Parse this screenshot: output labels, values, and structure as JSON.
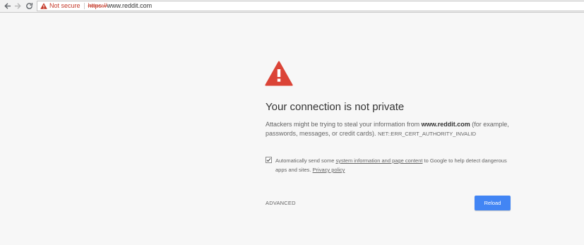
{
  "browser": {
    "security_label": "Not secure",
    "url_scheme": "https://",
    "url_host": "www.reddit.com"
  },
  "interstitial": {
    "heading": "Your connection is not private",
    "explanation_before": "Attackers might be trying to steal your information from ",
    "explanation_host": "www.reddit.com",
    "explanation_after": " (for example, passwords, messages, or credit cards). ",
    "error_code": "NET::ERR_CERT_AUTHORITY_INVALID",
    "optin_checked": true,
    "optin_before": "Automatically send some ",
    "optin_link": "system information and page content",
    "optin_after": " to Google to help detect dangerous apps and sites. ",
    "privacy_link": "Privacy policy",
    "advanced_label": "ADVANCED",
    "reload_label": "Reload"
  },
  "colors": {
    "warning_red": "#db4437",
    "reload_blue": "#4285f4",
    "background": "#f7f7f7"
  },
  "icons": [
    "back-arrow-icon",
    "forward-arrow-icon",
    "reload-icon",
    "warning-triangle-icon"
  ]
}
